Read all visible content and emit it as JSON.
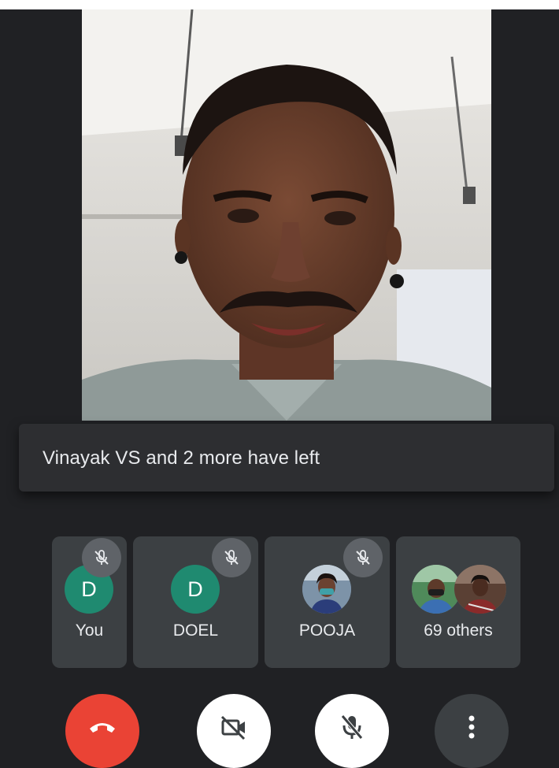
{
  "toast": {
    "message": "Vinayak VS and 2 more have left"
  },
  "participants": [
    {
      "name": "You",
      "avatar_letter": "D",
      "avatar_color": "#1f8a70",
      "muted": true
    },
    {
      "name": "DOEL",
      "avatar_letter": "D",
      "avatar_color": "#1f8a70",
      "muted": true
    },
    {
      "name": "POOJA",
      "avatar_letter": "",
      "muted": true
    },
    {
      "name": "69 others",
      "avatar_letter": ""
    }
  ],
  "controls": {
    "end_call": {
      "icon": "phone-hangup-icon",
      "color": "#ea4335"
    },
    "camera": {
      "icon": "video-off-icon",
      "state": "off"
    },
    "microphone": {
      "icon": "mic-off-icon",
      "state": "muted"
    },
    "more": {
      "icon": "more-vert-icon"
    }
  },
  "colors": {
    "background": "#202124",
    "tile": "#3c4043",
    "toast": "#2d2e31",
    "end_call": "#ea4335"
  }
}
